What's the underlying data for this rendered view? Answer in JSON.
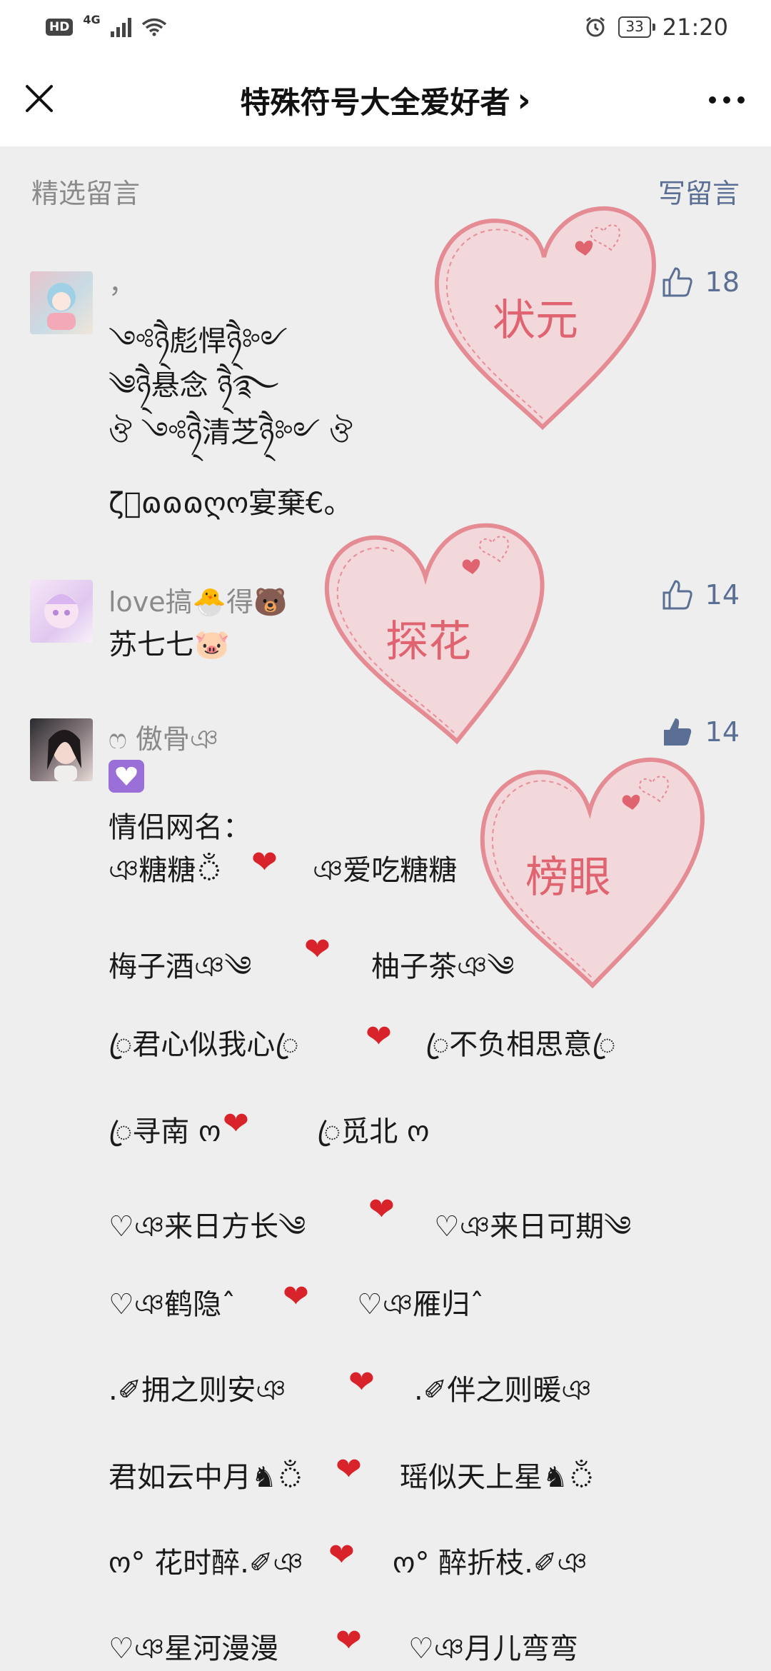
{
  "status_bar": {
    "hd": "HD",
    "network": "4G",
    "battery": "33",
    "time": "21:20"
  },
  "nav": {
    "title": "特殊符号大全爱好者",
    "chevron": "›",
    "close_icon": "close-icon",
    "more_icon": "more-icon"
  },
  "section": {
    "label": "精选留言",
    "write": "写留言"
  },
  "stamps": {
    "first": "状元",
    "second": "探花",
    "third": "榜眼"
  },
  "comments": [
    {
      "nickname": "，",
      "likes": "18",
      "lines": [
        "༺ཉ྄ཻ彪悍ཉ྄ཻ༻",
        "༄ཉ྄ཻ悬念 ཉ྄ཻ࿐",
        "ঔ ༺ཉ྄ཻ清芝ཉ྄ཻ༻ ঔ",
        "ζ⃟ɷɷɷღო宴棄€。"
      ]
    },
    {
      "nickname": "love搞🐣得🐻",
      "likes": "14",
      "lines": [
        "苏七七🐷"
      ]
    },
    {
      "nickname": "ෆ 傲骨ঞ",
      "likes": "14",
      "intro": "情侣网名：",
      "heart": "❤",
      "pairs": [
        {
          "a": "ঞ糖糖ঁ",
          "b": "ঞ爱吃糖糖"
        },
        {
          "a": "梅子酒ঞ༄",
          "b": "柚子茶ঞ༄"
        },
        {
          "a": "ꦿ君心似我心ꦿ",
          "b": "ꦿ不负相思意ꦿ"
        },
        {
          "a": "ꦿ寻南 ო",
          "b": "ꦿ觅北 ო"
        },
        {
          "a": "♡ঞ来日方长༄",
          "b": "♡ঞ来日可期༄"
        },
        {
          "a": "♡ঞ鹤隐ˆ",
          "b": "♡ঞ雁归ˆ"
        },
        {
          "a": ".✐拥之则安ঞ",
          "b": ".✐伴之则暖ঞ"
        },
        {
          "a": "君如云中月♞ঁ",
          "b": "瑶似天上星♞ঁ"
        },
        {
          "a": "ო° 花时醉.✐ঞ",
          "b": "ო° 醉折枝.✐ঞ"
        },
        {
          "a": "♡ঞ星河漫漫",
          "b": "♡ঞ月儿弯弯"
        }
      ]
    }
  ],
  "colors": {
    "accent": "#5b6e93",
    "heart_red": "#d8232a",
    "stamp_pink": "#e06370",
    "stamp_fill": "#f3d4d8"
  }
}
